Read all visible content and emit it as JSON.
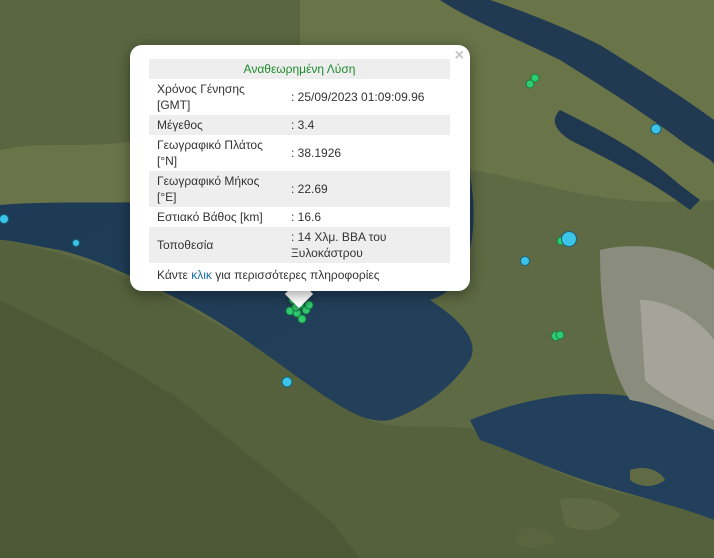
{
  "popup": {
    "title": "Αναθεωρημένη Λύση",
    "close": "×",
    "rows": [
      {
        "label": "Χρόνος Γένησης [GMT]",
        "value": ": 25/09/2023 01:09:09.96"
      },
      {
        "label": "Μέγεθος",
        "value": ": 3.4"
      },
      {
        "label": "Γεωγραφικό Πλάτος [°N]",
        "value": ": 38.1926"
      },
      {
        "label": "Γεωγραφικό Μήκος [°E]",
        "value": ": 22.69"
      },
      {
        "label": "Εστιακό Βάθος [km]",
        "value": ": 16.6"
      },
      {
        "label": "Τοποθεσία",
        "value": ": 14 Χλμ. ΒΒΑ του Ξυλοκάστρου"
      }
    ],
    "more_prefix": "Κάντε ",
    "more_link": "κλικ",
    "more_suffix": " για περισσότερες πληροφορίες"
  },
  "colors": {
    "recent_marker": "#2ecc71",
    "older_marker": "#3bc3e8",
    "title": "#1f8a2d",
    "link": "#1b6fa8"
  }
}
